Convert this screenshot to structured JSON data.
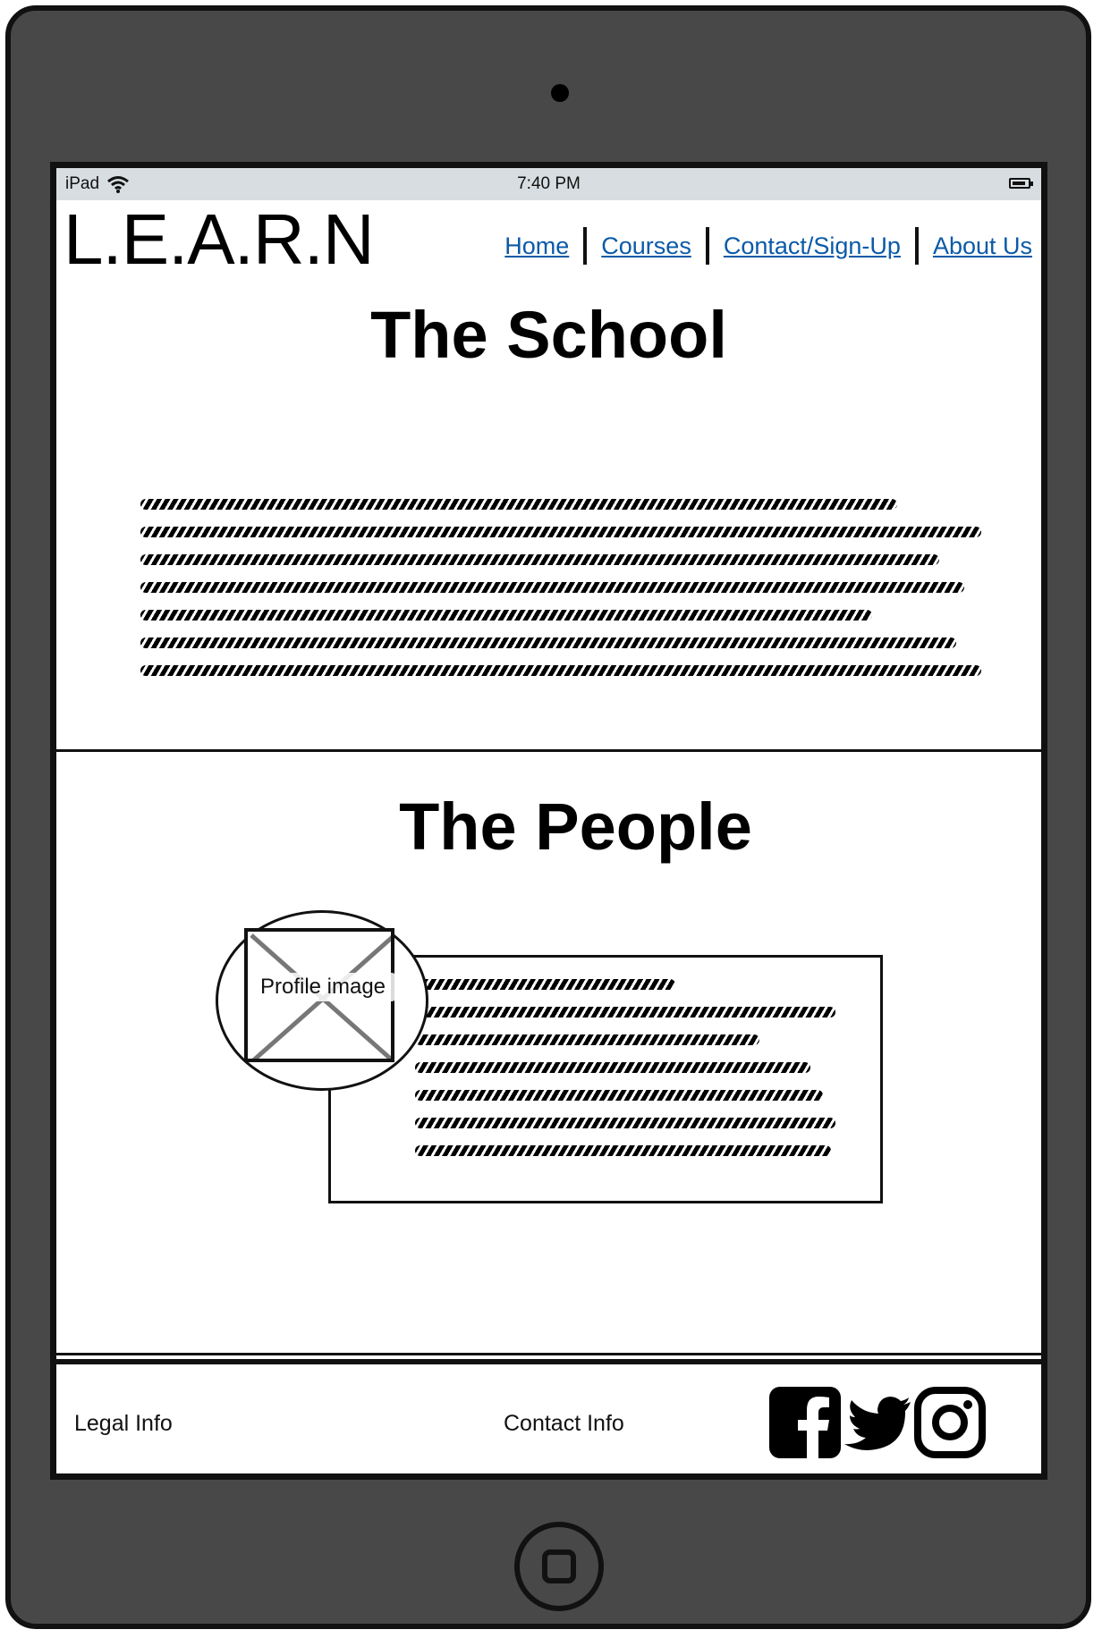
{
  "status_bar": {
    "device": "iPad",
    "time": "7:40 PM"
  },
  "header": {
    "logo": "L.E.A.R.N",
    "nav": [
      {
        "label": "Home"
      },
      {
        "label": "Courses"
      },
      {
        "label": "Contact/Sign-Up"
      },
      {
        "label": "About Us"
      }
    ]
  },
  "school_section": {
    "title": "The School"
  },
  "people_section": {
    "title": "The People",
    "profile_image_label": "Profile image"
  },
  "footer": {
    "legal": "Legal Info",
    "contact": "Contact Info",
    "social_icons": [
      "facebook-icon",
      "twitter-icon",
      "instagram-icon"
    ]
  },
  "colors": {
    "device_frame": "#484848",
    "link": "#0b5aa8",
    "status_bar": "#d8dde1"
  }
}
